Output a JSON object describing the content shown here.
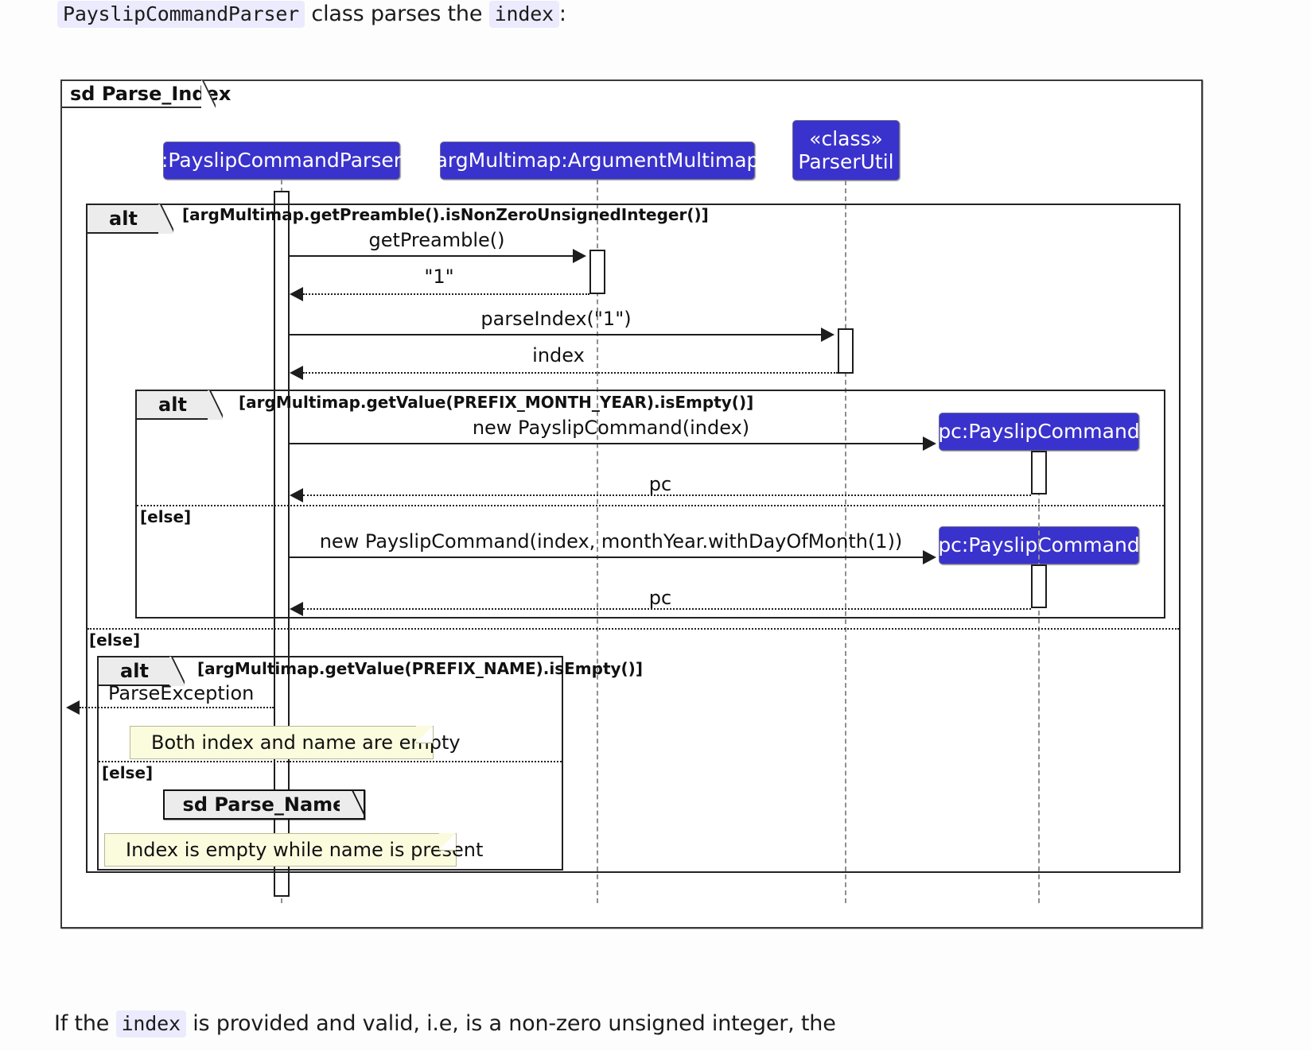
{
  "top_text": {
    "chip1": "PayslipCommandParser",
    "mid": "class parses the",
    "chip2": "index",
    "tail": ":"
  },
  "bottom_text": {
    "lead": "If the",
    "chip": "index",
    "tail": "is provided and valid, i.e, is a non-zero unsigned integer, the"
  },
  "diagram": {
    "frame_label": "sd Parse_Index",
    "lifelines": [
      {
        "name": "payslip-command-parser",
        "label": ":PayslipCommandParser"
      },
      {
        "name": "arg-multimap",
        "label": "argMultimap:ArgumentMultimap"
      },
      {
        "name": "parser-util",
        "label": "«class»\nParserUtil"
      },
      {
        "name": "payslip-command-1",
        "label": "pc:PayslipCommand"
      },
      {
        "name": "payslip-command-2",
        "label": "pc:PayslipCommand"
      }
    ],
    "fragments": {
      "outer_alt": {
        "operator": "alt",
        "guard": "[argMultimap.getPreamble().isNonZeroUnsignedInteger()]",
        "else_label": "[else]"
      },
      "inner_alt_month": {
        "operator": "alt",
        "guard": "[argMultimap.getValue(PREFIX_MONTH_YEAR).isEmpty()]",
        "else_label": "[else]"
      },
      "inner_alt_name": {
        "operator": "alt",
        "guard": "[argMultimap.getValue(PREFIX_NAME).isEmpty()]",
        "else_label": "[else]"
      }
    },
    "messages": [
      {
        "name": "get-preamble",
        "label": "getPreamble()"
      },
      {
        "name": "preamble-return",
        "label": "\"1\""
      },
      {
        "name": "parse-index",
        "label": "parseIndex(\"1\")"
      },
      {
        "name": "index-return",
        "label": "index"
      },
      {
        "name": "new-payslip-command-index",
        "label": "new PayslipCommand(index)"
      },
      {
        "name": "pc-return-1",
        "label": "pc"
      },
      {
        "name": "new-payslip-command-monthyear",
        "label": "new PayslipCommand(index, monthYear.withDayOfMonth(1))"
      },
      {
        "name": "pc-return-2",
        "label": "pc"
      },
      {
        "name": "parse-exception",
        "label": "ParseException"
      }
    ],
    "ref": {
      "label": "sd Parse_Name"
    },
    "notes": [
      {
        "name": "note-both-empty",
        "text": "Both index and name are empty"
      },
      {
        "name": "note-index-empty",
        "text": "Index is empty while name is present"
      }
    ]
  },
  "colors": {
    "lifeline_fill": "#3a32cc",
    "note_fill": "#fbfbdd",
    "fragment_label_fill": "#ececec",
    "chip_fill": "#eceafd"
  }
}
